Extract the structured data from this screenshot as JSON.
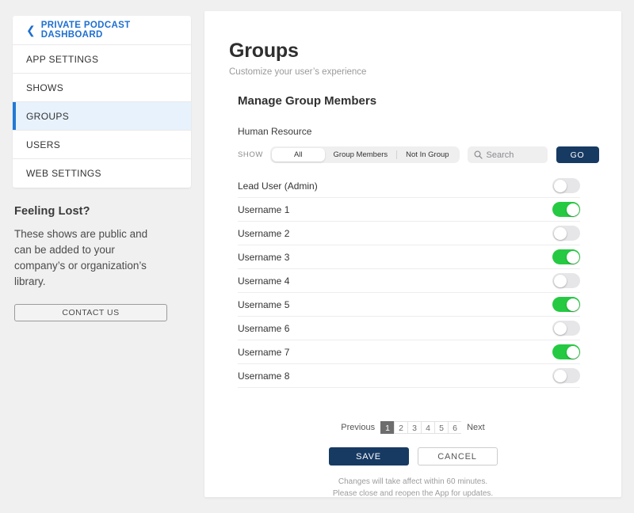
{
  "sidebar": {
    "header": {
      "label": "PRIVATE PODCAST DASHBOARD",
      "chevron": "chevron-left-icon"
    },
    "items": [
      {
        "label": "APP SETTINGS",
        "active": false
      },
      {
        "label": "SHOWS",
        "active": false
      },
      {
        "label": "GROUPS",
        "active": true
      },
      {
        "label": "USERS",
        "active": false
      },
      {
        "label": "WEB SETTINGS",
        "active": false
      }
    ],
    "help": {
      "title": "Feeling Lost?",
      "body": "These shows are public and can be added to your company’s or organization’s library.",
      "button": "CONTACT US"
    }
  },
  "main": {
    "title": "Groups",
    "subtitle": "Customize your user’s experience",
    "section_title": "Manage Group Members",
    "group_name": "Human Resource",
    "toolbar": {
      "show_label": "SHOW",
      "segments": [
        {
          "label": "All",
          "active": true
        },
        {
          "label": "Group Members",
          "active": false
        },
        {
          "label": "Not In Group",
          "active": false
        }
      ],
      "search_placeholder": "Search",
      "search_value": "",
      "search_icon": "search-icon",
      "go_label": "GO"
    },
    "members": [
      {
        "name": "Lead User (Admin)",
        "enabled": false
      },
      {
        "name": "Username 1",
        "enabled": true
      },
      {
        "name": "Username 2",
        "enabled": false
      },
      {
        "name": "Username 3",
        "enabled": true
      },
      {
        "name": "Username 4",
        "enabled": false
      },
      {
        "name": "Username 5",
        "enabled": true
      },
      {
        "name": "Username 6",
        "enabled": false
      },
      {
        "name": "Username 7",
        "enabled": true
      },
      {
        "name": "Username 8",
        "enabled": false
      }
    ],
    "pagination": {
      "previous": "Previous",
      "next": "Next",
      "pages": [
        "1",
        "2",
        "3",
        "4",
        "5",
        "6"
      ],
      "current": "1"
    },
    "actions": {
      "save": "SAVE",
      "cancel": "CANCEL"
    },
    "footnote_line1": "Changes will take affect within 60 minutes.",
    "footnote_line2": "Please close and reopen the App for updates."
  },
  "colors": {
    "accent_blue": "#1d6fd0",
    "navy": "#173a63",
    "toggle_on": "#25ca42",
    "toggle_off": "#e6e6e8",
    "active_row": "#e8f2fd",
    "page_bg": "#f0f0f0"
  }
}
